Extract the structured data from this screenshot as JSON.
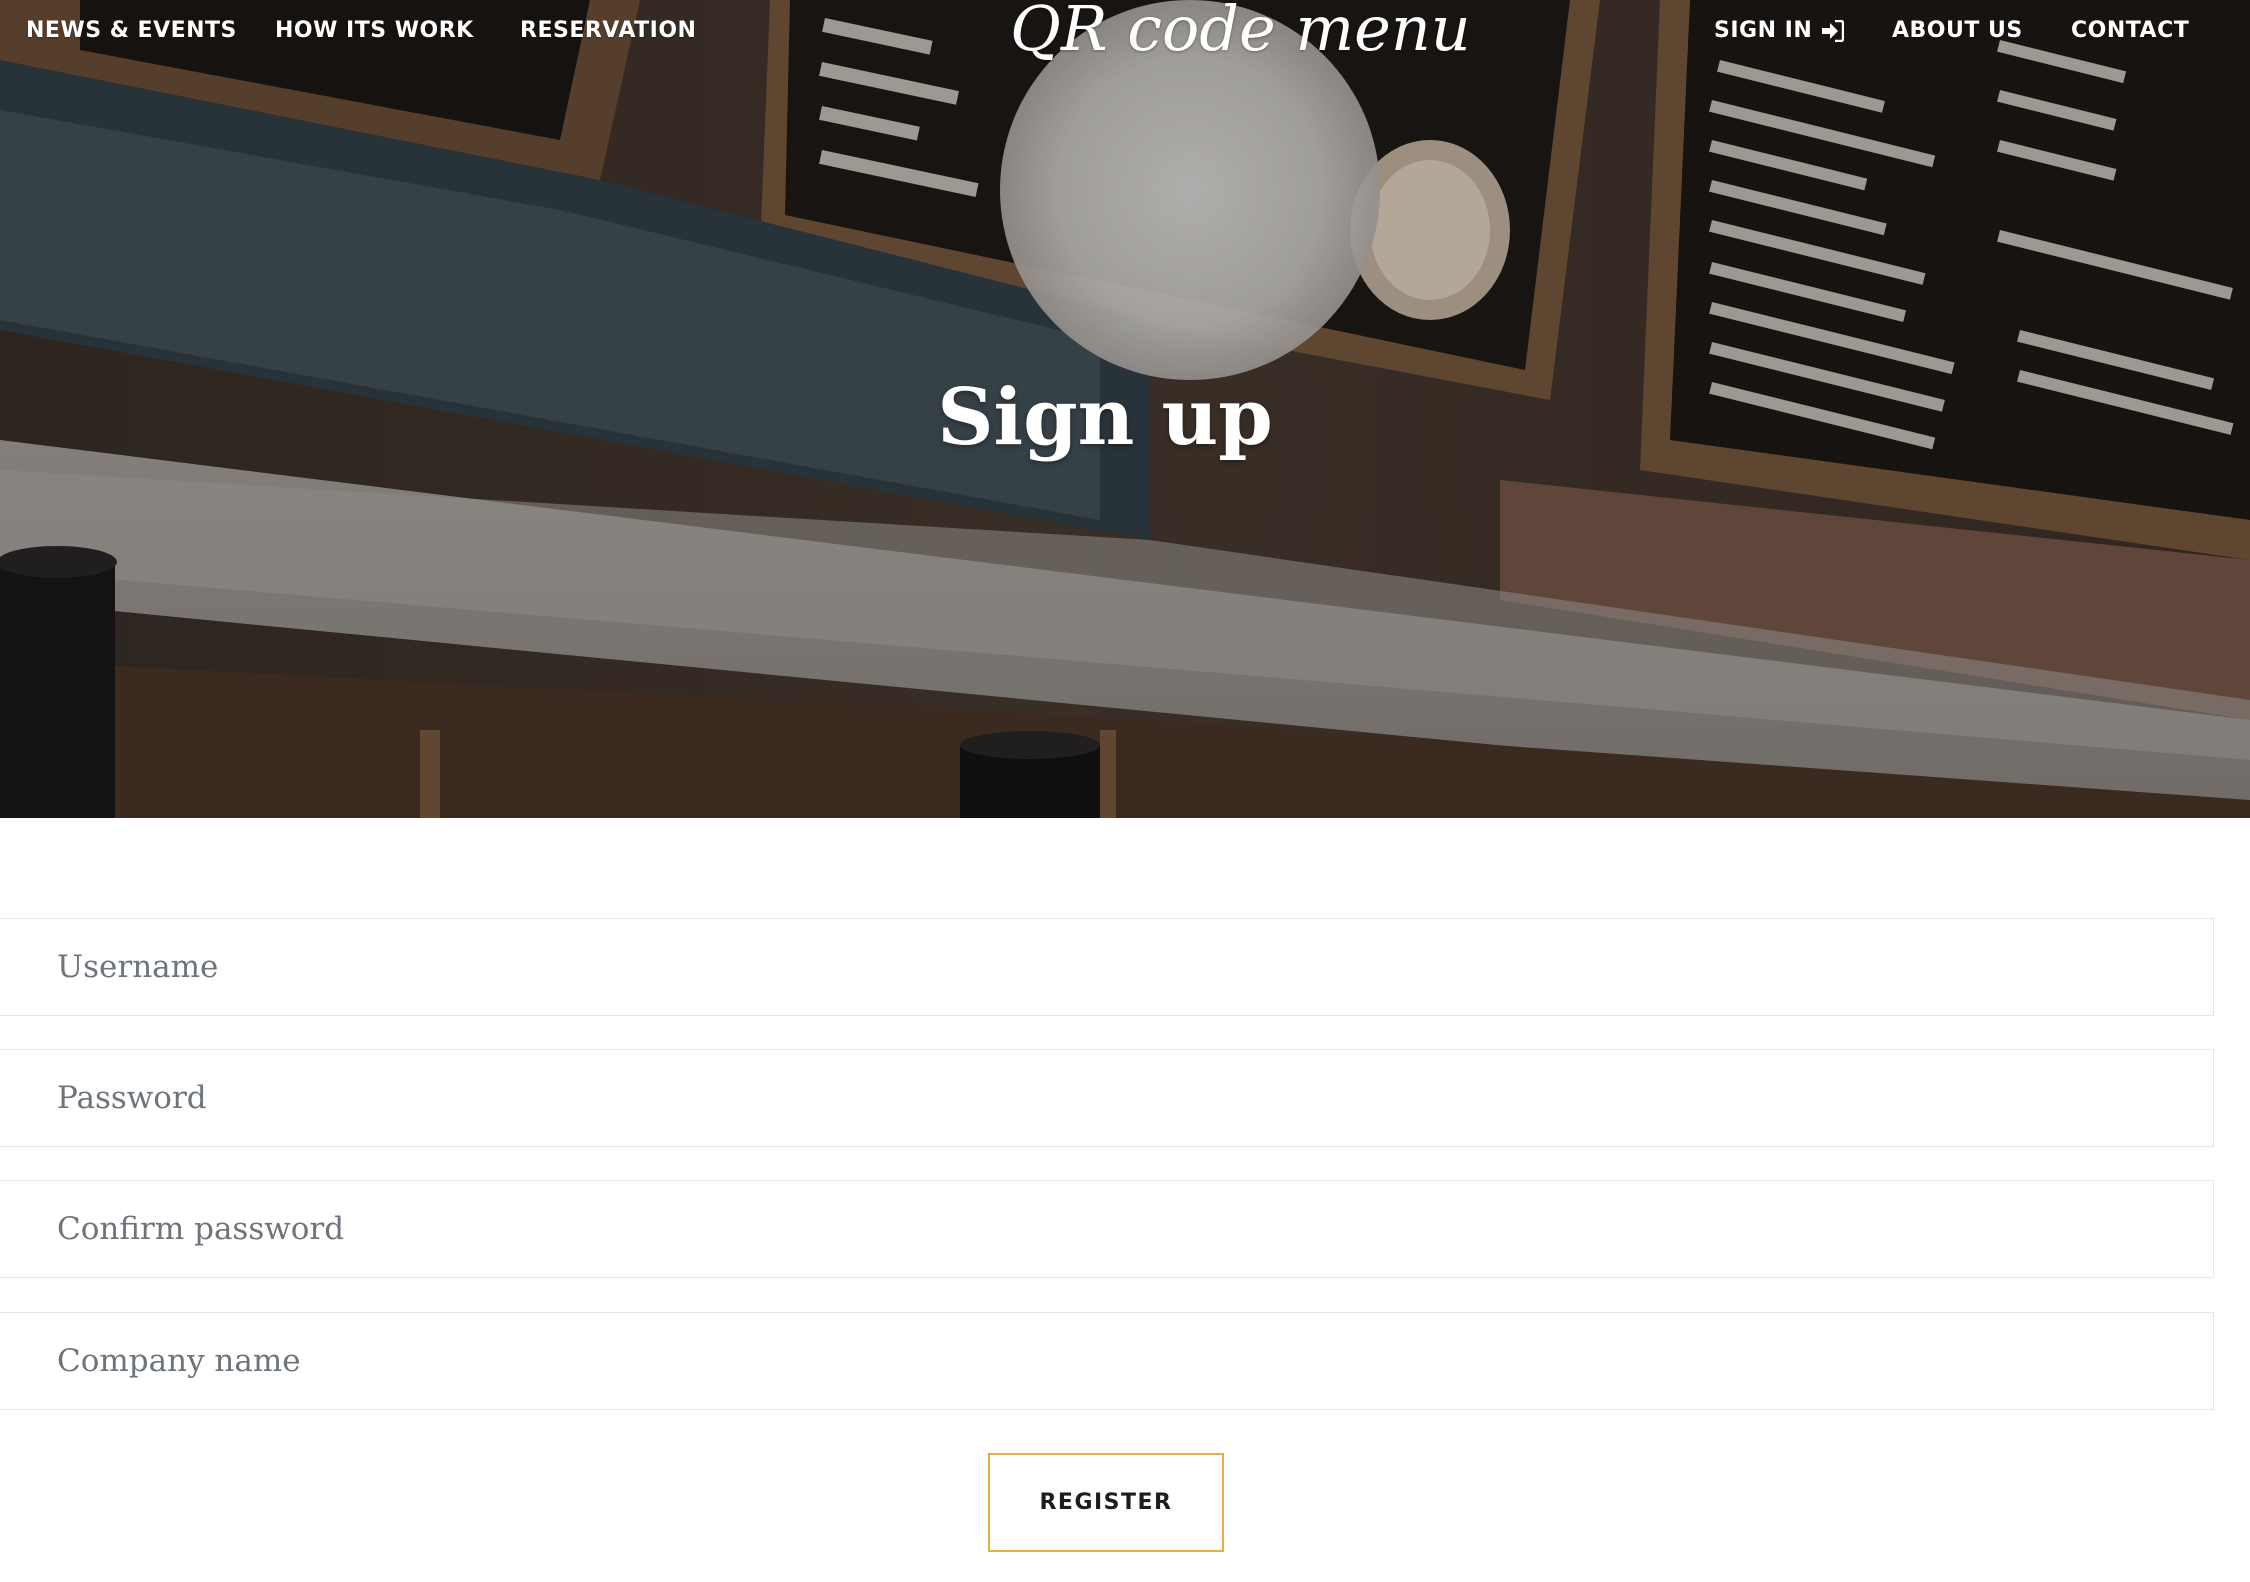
{
  "nav": {
    "left_links": [
      "NEWS & EVENTS",
      "HOW ITS WORK",
      "RESERVATION"
    ],
    "logo": "QR code menu",
    "sign_in": "SIGN IN",
    "sign_in_icon": "sign-in-icon",
    "right_links": [
      "ABOUT US",
      "CONTACT"
    ]
  },
  "hero": {
    "title": "Sign up"
  },
  "form": {
    "username_placeholder": "Username",
    "password_placeholder": "Password",
    "confirm_password_placeholder": "Confirm password",
    "company_placeholder": "Company name",
    "register_label": "REGISTER"
  },
  "colors": {
    "accent": "#e8ae45",
    "nav_text": "#ffffff",
    "placeholder": "#6d747b",
    "field_border": "#e6e6e6"
  }
}
